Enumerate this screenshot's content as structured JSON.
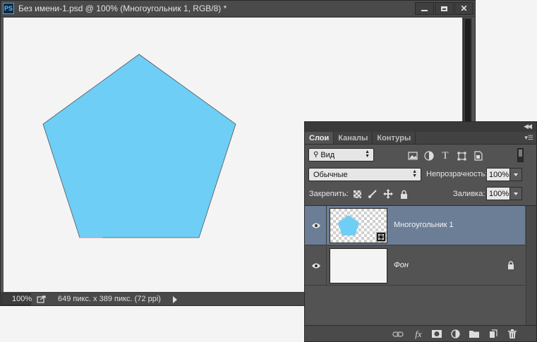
{
  "document": {
    "app_icon": "PS",
    "title": "Без имени-1.psd @ 100% (Многоугольник 1, RGB/8) *",
    "window_controls": [
      "minimize-icon",
      "maximize-icon",
      "close-icon"
    ],
    "canvas": {
      "background": "#f4f4f4",
      "shape": {
        "type": "pentagon",
        "fill": "#6ecef6",
        "stroke": "#555555"
      }
    },
    "status": {
      "zoom": "100%",
      "info": "649 пикс. x 389 пикс. (72 ppi)"
    }
  },
  "layers_panel": {
    "collapse_icon": "double-chevron-icon",
    "tabs": [
      {
        "label": "Слои",
        "active": true
      },
      {
        "label": "Каналы",
        "active": false
      },
      {
        "label": "Контуры",
        "active": false
      }
    ],
    "filter": {
      "kind_label": "Вид",
      "icons": [
        "image-filter-icon",
        "adjustment-filter-icon",
        "type-filter-icon",
        "shape-filter-icon",
        "smart-object-filter-icon"
      ]
    },
    "blend_mode": "Обычные",
    "opacity_label": "Непрозрачность:",
    "opacity_value": "100%",
    "lock_label": "Закрепить:",
    "lock_icons": [
      "lock-transparency-icon",
      "lock-pixels-icon",
      "lock-position-icon",
      "lock-all-icon"
    ],
    "fill_label": "Заливка:",
    "fill_value": "100%",
    "layers": [
      {
        "name": "Многоугольник 1",
        "selected": true,
        "visible": true,
        "type": "shape",
        "locked": false
      },
      {
        "name": "Фон",
        "selected": false,
        "visible": true,
        "type": "background",
        "locked": true
      }
    ],
    "bottom_icons": [
      "link-icon",
      "fx-icon",
      "mask-icon",
      "adjustment-icon",
      "folder-icon",
      "new-layer-icon",
      "trash-icon"
    ],
    "bottom_fx_label": "fx"
  },
  "colors": {
    "selection": "#6b7e96",
    "shape_fill": "#6ecef6",
    "panel_bg": "#535353"
  }
}
